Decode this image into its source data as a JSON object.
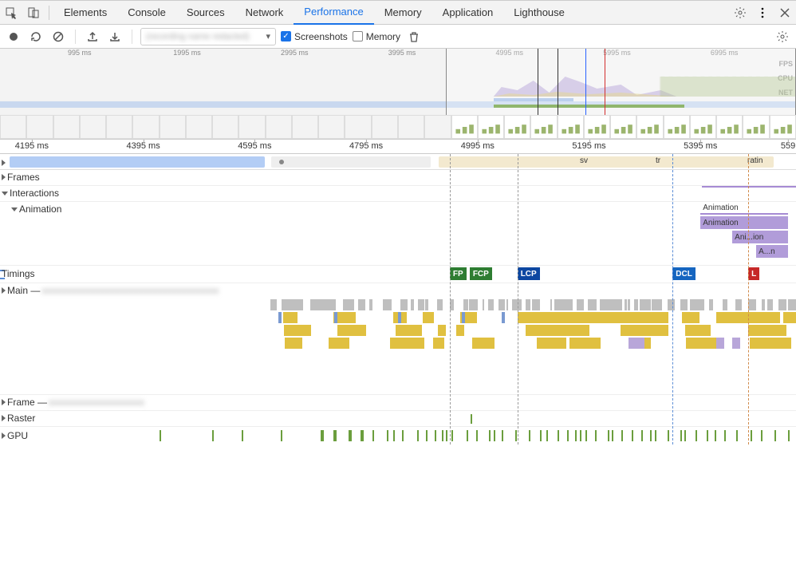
{
  "tabs": {
    "elements": "Elements",
    "console": "Console",
    "sources": "Sources",
    "network": "Network",
    "performance": "Performance",
    "memory": "Memory",
    "application": "Application",
    "lighthouse": "Lighthouse"
  },
  "toolbar": {
    "screenshots_label": "Screenshots",
    "memory_label": "Memory",
    "screenshots_checked": true,
    "memory_checked": false,
    "profile_dropdown_placeholder": "(recording name redacted)"
  },
  "overview": {
    "ticks": [
      "995 ms",
      "1995 ms",
      "2995 ms",
      "3995 ms",
      "4995 ms",
      "5995 ms",
      "6995 ms"
    ],
    "lanes": [
      "FPS",
      "CPU",
      "NET"
    ],
    "selection": {
      "start_pct": 56,
      "end_pct": 100
    }
  },
  "detail": {
    "ticks": [
      "4195 ms",
      "4395 ms",
      "4595 ms",
      "4795 ms",
      "4995 ms",
      "5195 ms",
      "5395 ms",
      "559"
    ],
    "tick_positions_pct": [
      4,
      18,
      32,
      46,
      60,
      74,
      88,
      99
    ]
  },
  "tracks": {
    "frames": "Frames",
    "interactions": "Interactions",
    "animation_sub": "Animation",
    "timings": "Timings",
    "main": "Main —",
    "frame": "Frame —",
    "raster": "Raster",
    "gpu": "GPU"
  },
  "network_markers": {
    "sv": "sv",
    "tr": "tr",
    "ratin": "ratin"
  },
  "interactions": {
    "blocks": [
      {
        "label": "Animation",
        "left_pct": 88,
        "width_pct": 11,
        "row": 0,
        "shade": "lightpurple"
      },
      {
        "label": "Animation",
        "left_pct": 88,
        "width_pct": 11,
        "row": 1,
        "shade": "purple"
      },
      {
        "label": "Ani...ion",
        "left_pct": 92,
        "width_pct": 7,
        "row": 2,
        "shade": "purple"
      },
      {
        "label": "A...n",
        "left_pct": 95,
        "width_pct": 4,
        "row": 3,
        "shade": "purple"
      }
    ]
  },
  "timings": {
    "badges": [
      {
        "label": "FP",
        "left_pct": 56.5,
        "color": "#2e7d32"
      },
      {
        "label": "FCP",
        "left_pct": 59,
        "color": "#2e7d32"
      },
      {
        "label": "LCP",
        "left_pct": 65,
        "color": "#0d47a1"
      },
      {
        "label": "DCL",
        "left_pct": 84.5,
        "color": "#1565c0"
      },
      {
        "label": "L",
        "left_pct": 94,
        "color": "#c62828"
      }
    ]
  },
  "vlines": [
    {
      "left_pct": 56.5,
      "color": "#999"
    },
    {
      "left_pct": 65,
      "color": "#999"
    },
    {
      "left_pct": 84.5,
      "color": "#5b8dd6"
    },
    {
      "left_pct": 94,
      "color": "#d08a4a"
    }
  ]
}
